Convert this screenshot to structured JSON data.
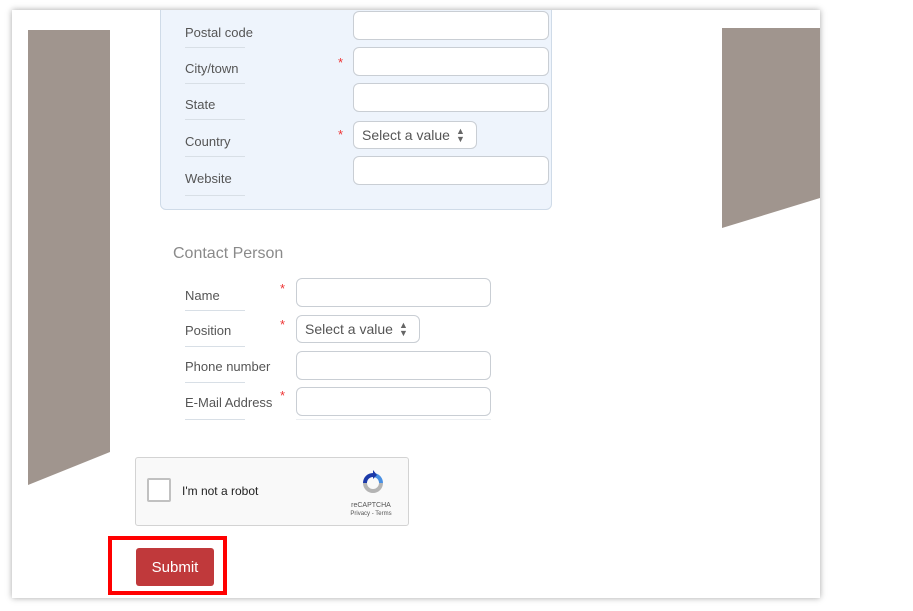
{
  "address": {
    "fields": [
      {
        "label": "Postal code",
        "required": false,
        "type": "input"
      },
      {
        "label": "City/town",
        "required": true,
        "type": "input"
      },
      {
        "label": "State",
        "required": false,
        "type": "input"
      },
      {
        "label": "Country",
        "required": true,
        "type": "select",
        "value": "Select a value"
      },
      {
        "label": "Website",
        "required": false,
        "type": "input"
      }
    ]
  },
  "contact": {
    "title": "Contact Person",
    "fields": [
      {
        "label": "Name",
        "required": true,
        "type": "input"
      },
      {
        "label": "Position",
        "required": true,
        "type": "select",
        "value": "Select a value"
      },
      {
        "label": "Phone number",
        "required": false,
        "type": "input"
      },
      {
        "label": "E-Mail Address",
        "required": true,
        "type": "input"
      }
    ]
  },
  "required_mark": "*",
  "captcha": {
    "label": "I'm not a robot",
    "brand": "reCAPTCHA",
    "links": "Privacy - Terms"
  },
  "submit_label": "Submit",
  "colors": {
    "submit": "#c0393b",
    "highlight": "#ff0000",
    "panel": "#eef4fc",
    "decoration": "#a0958e"
  }
}
